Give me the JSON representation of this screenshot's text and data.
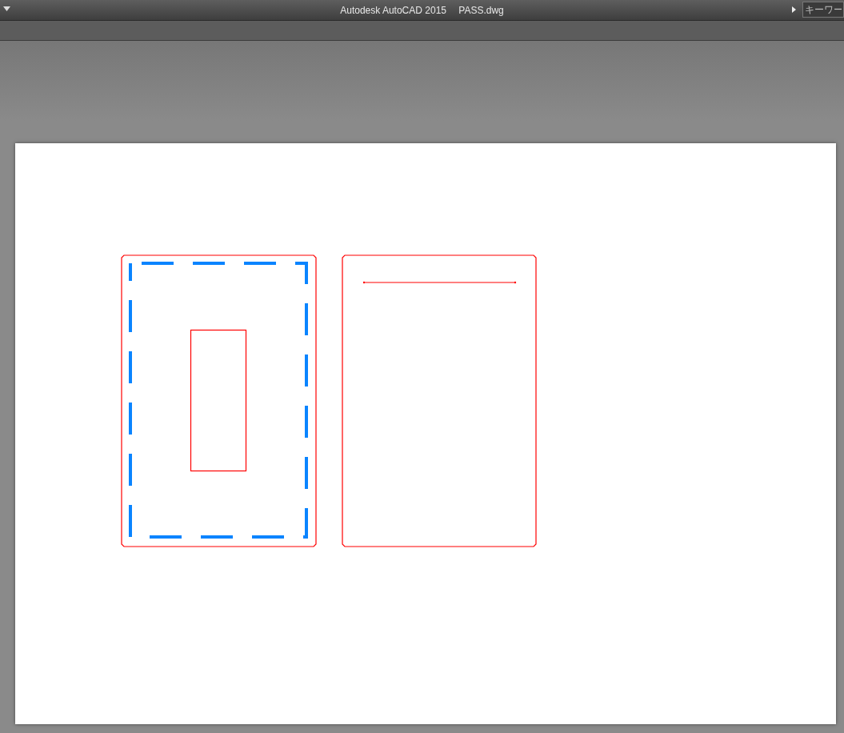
{
  "window": {
    "title": "Autodesk AutoCAD 2015",
    "file_name": "PASS.dwg"
  },
  "search": {
    "placeholder": "キーワー"
  }
}
